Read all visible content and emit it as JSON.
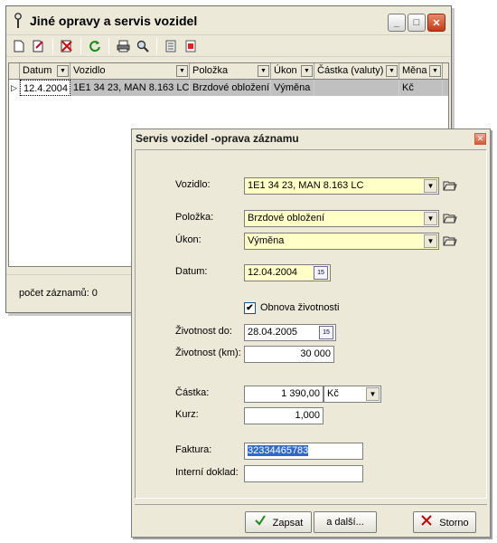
{
  "main": {
    "title": "Jiné opravy a servis vozidel",
    "window_buttons": {
      "minimize": "_",
      "maximize": "□",
      "close": "✕"
    },
    "toolbar_icons": [
      "new-document-icon",
      "edit-document-icon",
      "delete-icon",
      "refresh-icon",
      "print-icon",
      "search-icon",
      "list-icon",
      "report-icon"
    ],
    "columns": [
      "Datum",
      "Vozidlo",
      "Položka",
      "Úkon",
      "Částka (valuty)",
      "Měna"
    ],
    "rows": [
      {
        "marker": "▷",
        "datum": "12.4.2004",
        "vozidlo": "1E1 34 23, MAN 8.163 LC",
        "polozka": "Brzdové obložení",
        "ukon": "Výměna",
        "castka": "",
        "mena": "Kč"
      }
    ],
    "status": "počet záznamů: 0"
  },
  "dialog": {
    "title": "Servis vozidel -oprava záznamu",
    "close": "✕",
    "labels": {
      "vozidlo": "Vozidlo:",
      "polozka": "Položka:",
      "ukon": "Úkon:",
      "datum": "Datum:",
      "obnova": "Obnova životnosti",
      "zivotnost_do": "Životnost do:",
      "zivotnost_km": "Životnost (km):",
      "castka": "Částka:",
      "kurz": "Kurz:",
      "faktura": "Faktura:",
      "interni": "Interní doklad:"
    },
    "values": {
      "vozidlo": "1E1 34 23, MAN 8.163 LC",
      "polozka": "Brzdové obložení",
      "ukon": "Výměna",
      "datum": "12.04.2004",
      "obnova_checked": true,
      "zivotnost_do": "28.04.2005",
      "zivotnost_km": "30 000",
      "castka": "1 390,00",
      "mena": "Kč",
      "kurz": "1,000",
      "faktura": "32334465783",
      "interni": ""
    },
    "calendar_label": "15",
    "buttons": {
      "zapsat": "Zapsat",
      "dalsi": "a další...",
      "storno": "Storno"
    }
  },
  "colors": {
    "yellow_field": "#ffffc8",
    "selection": "#316ac5",
    "window_bg": "#ece9d8"
  }
}
